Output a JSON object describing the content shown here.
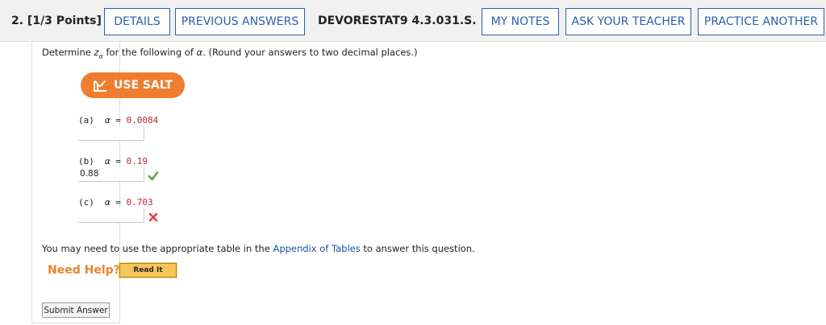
{
  "header": {
    "question_label": "2. [1/3 Points]",
    "details_label": "DETAILS",
    "previous_answers_label": "PREVIOUS ANSWERS",
    "question_code": "DEVORESTAT9 4.3.031.S.",
    "my_notes_label": "MY NOTES",
    "ask_teacher_label": "ASK YOUR TEACHER",
    "practice_another_label": "PRACTICE ANOTHER"
  },
  "prompt": {
    "before": "Determine ",
    "variable": "z",
    "subscript": "α",
    "after": " for the following of ",
    "alpha": "α",
    "tail": ". (Round your answers to two decimal places.)"
  },
  "salt_button_label": "USE SALT",
  "parts": [
    {
      "label": "(a)",
      "alpha": "α",
      "equals": " = ",
      "value": "0.0084",
      "answer": "",
      "status": "none"
    },
    {
      "label": "(b)",
      "alpha": "α",
      "equals": " = ",
      "value": "0.19",
      "answer": "0.88",
      "status": "correct"
    },
    {
      "label": "(c)",
      "alpha": "α",
      "equals": " = ",
      "value": "0.703",
      "answer": "",
      "status": "incorrect"
    }
  ],
  "appendix": {
    "before": "You may need to use the appropriate table in the ",
    "link": "Appendix of Tables",
    "after": " to answer this question."
  },
  "help": {
    "need_help_label": "Need Help?",
    "read_it_label": "Read It"
  },
  "submit_label": "Submit Answer",
  "colors": {
    "accent_blue": "#2a5fae",
    "salt_orange": "#ef7d2f",
    "value_red": "#c0272d",
    "correct_green": "#5aa83a",
    "incorrect_red": "#e0404a"
  }
}
